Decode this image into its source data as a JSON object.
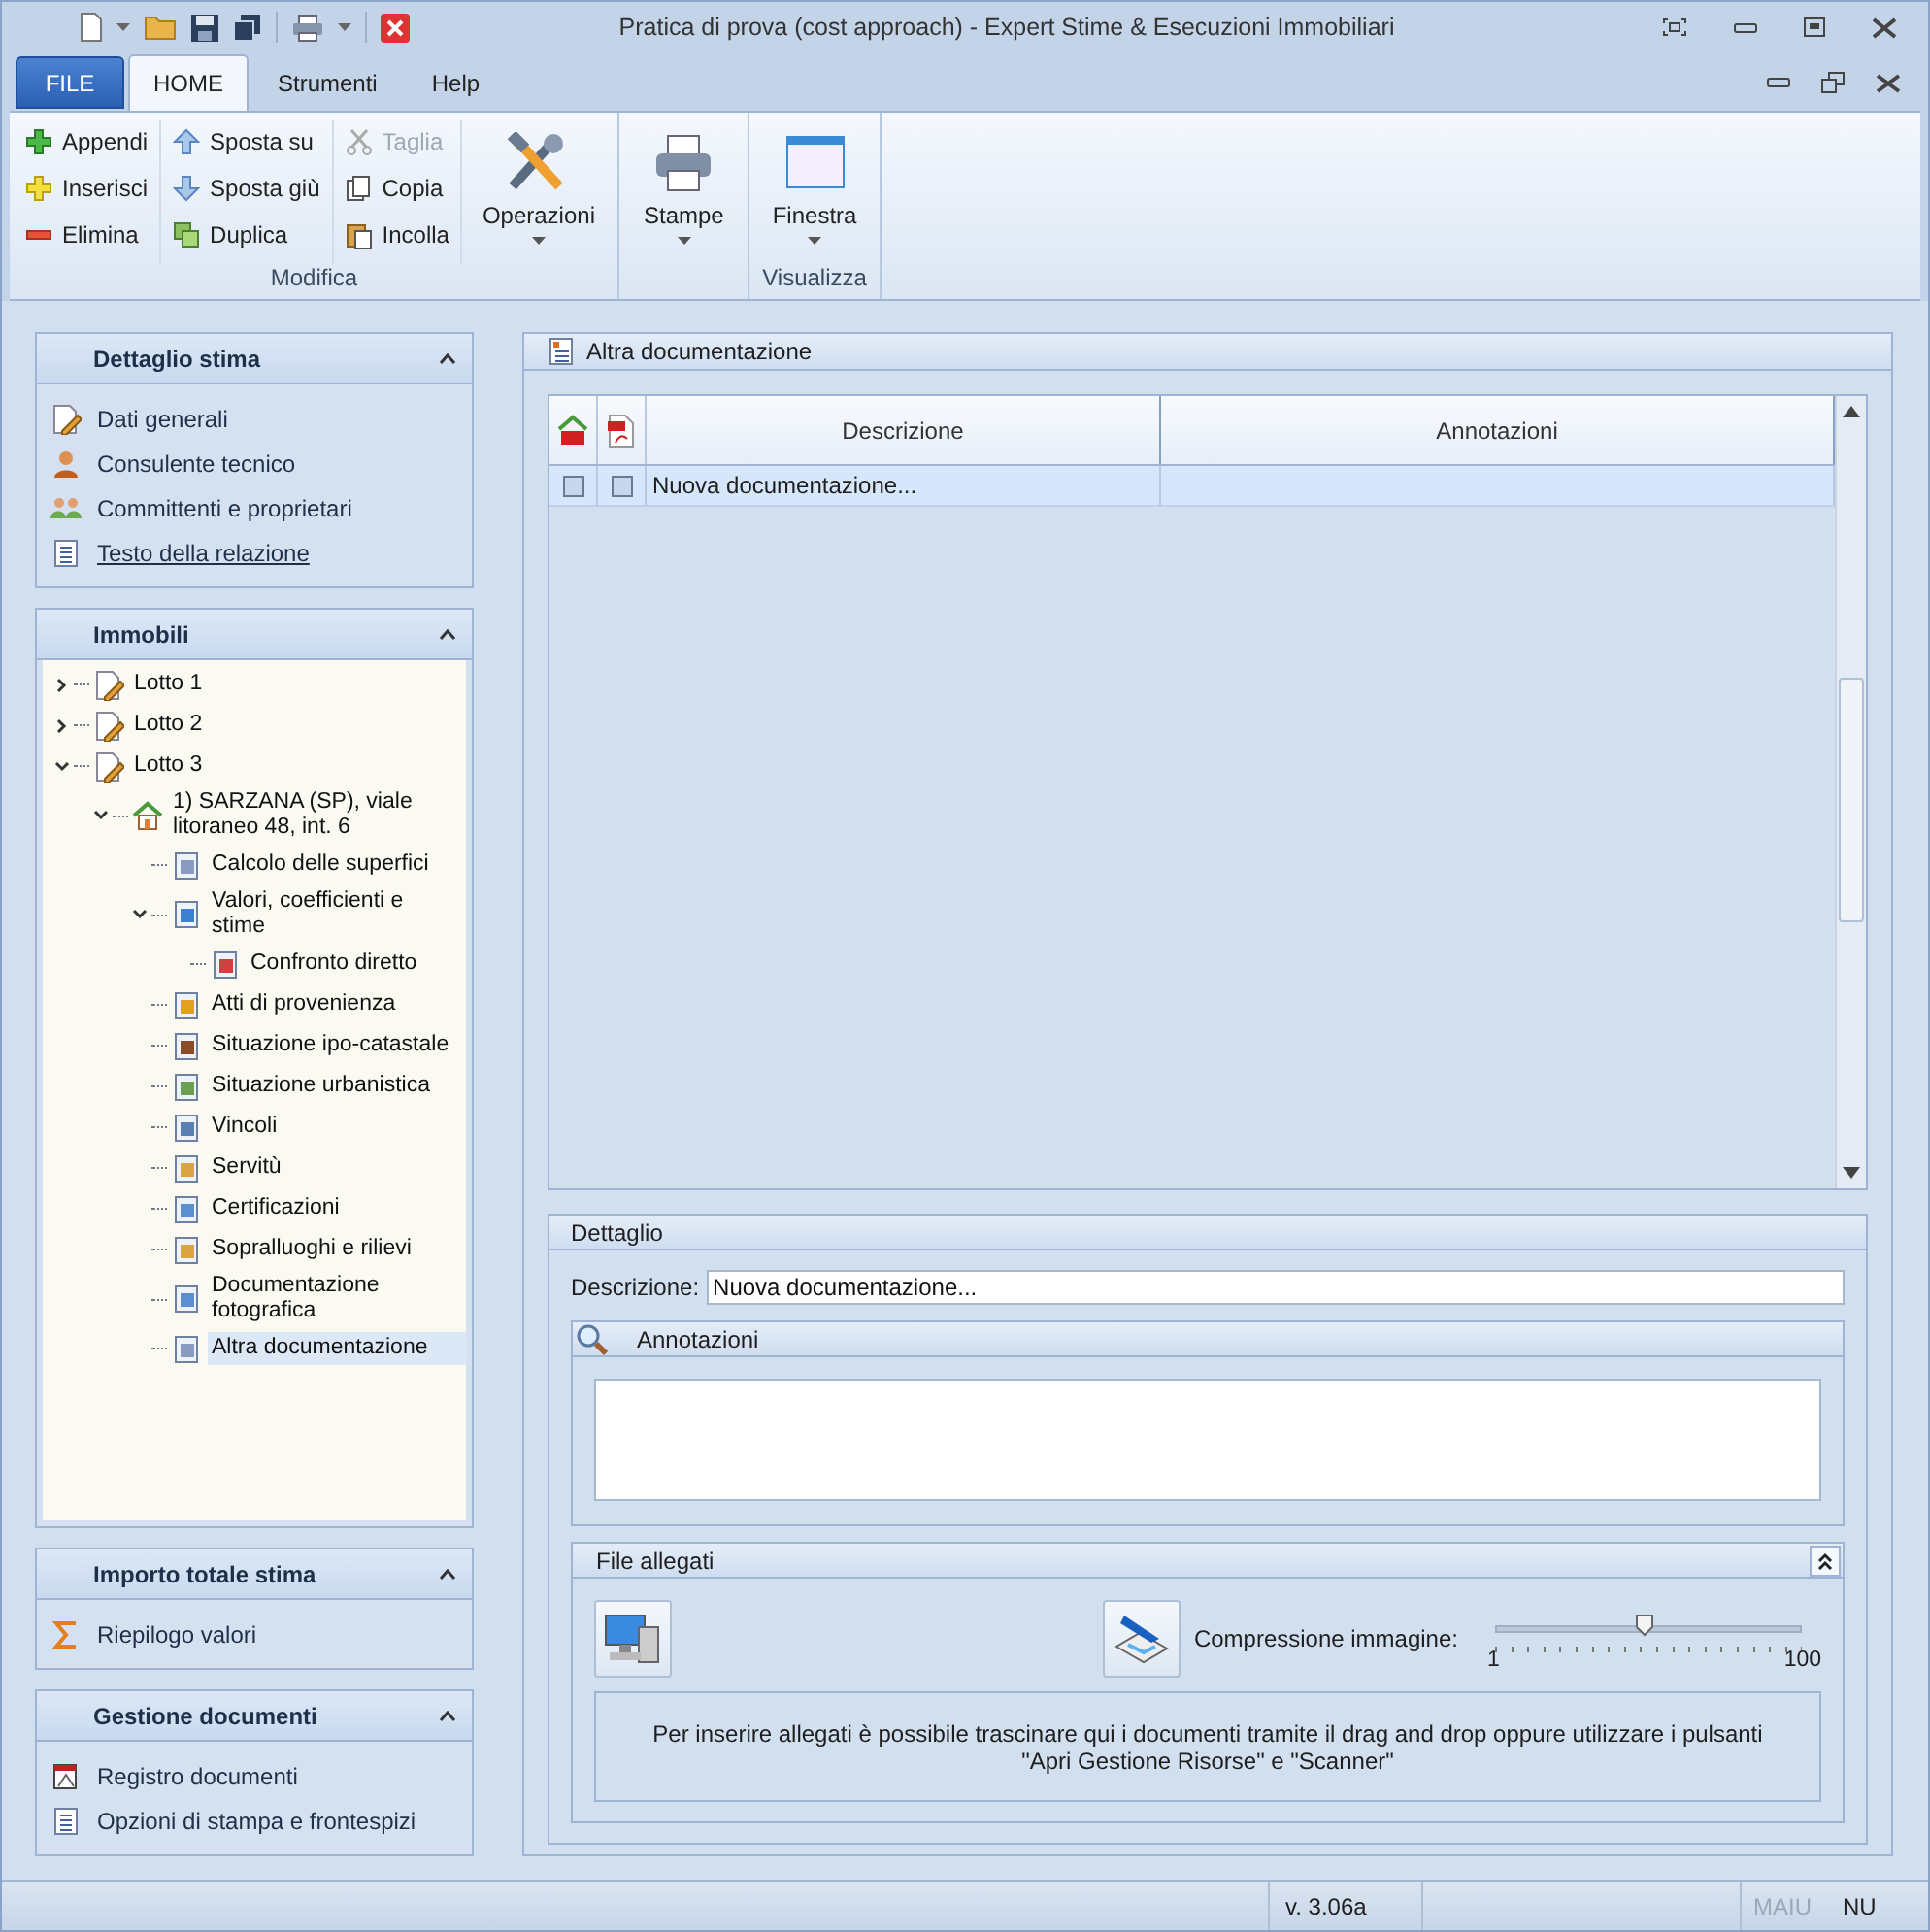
{
  "window": {
    "title": "Pratica di prova (cost approach) - Expert Stime & Esecuzioni Immobiliari"
  },
  "ribbon_tabs": [
    {
      "label": "FILE",
      "kind": "file",
      "selected": false
    },
    {
      "label": "HOME",
      "kind": "tab",
      "selected": true
    },
    {
      "label": "Strumenti",
      "kind": "tab",
      "selected": false
    },
    {
      "label": "Help",
      "kind": "tab",
      "selected": false
    }
  ],
  "ribbon_groups": [
    {
      "label": "Modifica",
      "small_columns": [
        [
          {
            "label": "Appendi",
            "disabled": false
          },
          {
            "label": "Inserisci",
            "disabled": false
          },
          {
            "label": "Elimina",
            "disabled": false
          }
        ],
        [
          {
            "label": "Sposta su",
            "disabled": false
          },
          {
            "label": "Sposta giù",
            "disabled": false
          },
          {
            "label": "Duplica",
            "disabled": false
          }
        ],
        [
          {
            "label": "Taglia",
            "disabled": true
          },
          {
            "label": "Copia",
            "disabled": false
          },
          {
            "label": "Incolla",
            "disabled": false
          }
        ]
      ],
      "large_buttons": [
        {
          "label": "Operazioni"
        }
      ]
    },
    {
      "large_buttons": [
        {
          "label": "Stampe"
        }
      ]
    },
    {
      "label": "Visualizza",
      "large_buttons": [
        {
          "label": "Finestra"
        }
      ]
    }
  ],
  "sidebar": {
    "panels": [
      {
        "title": "Dettaglio stima",
        "kind": "links",
        "expanded": true,
        "items": [
          {
            "label": "Dati generali",
            "hovered": false
          },
          {
            "label": "Consulente tecnico",
            "hovered": false
          },
          {
            "label": "Committenti e proprietari",
            "hovered": false
          },
          {
            "label": "Testo della relazione",
            "hovered": true
          }
        ]
      },
      {
        "title": "Immobili",
        "kind": "tree",
        "expanded": true,
        "tree": [
          {
            "label": "Lotto 1",
            "expanded": false,
            "selected": false
          },
          {
            "label": "Lotto 2",
            "expanded": false,
            "selected": false
          },
          {
            "label": "Lotto 3",
            "expanded": true,
            "selected": false,
            "children": [
              {
                "label": "1) SARZANA (SP), viale litoraneo 48, int. 6",
                "expanded": true,
                "selected": false,
                "children": [
                  {
                    "label": "Calcolo delle superfici",
                    "selected": false
                  },
                  {
                    "label": "Valori, coefficienti e stime",
                    "expanded": true,
                    "selected": false,
                    "children": [
                      {
                        "label": "Confronto diretto",
                        "selected": false
                      }
                    ]
                  },
                  {
                    "label": "Atti di provenienza",
                    "selected": false
                  },
                  {
                    "label": "Situazione ipo-catastale",
                    "selected": false
                  },
                  {
                    "label": "Situazione urbanistica",
                    "selected": false
                  },
                  {
                    "label": "Vincoli",
                    "selected": false
                  },
                  {
                    "label": "Servitù",
                    "selected": false
                  },
                  {
                    "label": "Certificazioni",
                    "selected": false
                  },
                  {
                    "label": "Sopralluoghi e rilievi",
                    "selected": false
                  },
                  {
                    "label": "Documentazione fotografica",
                    "selected": false
                  },
                  {
                    "label": "Altra documentazione",
                    "selected": true
                  }
                ]
              }
            ]
          }
        ]
      },
      {
        "title": "Importo totale stima",
        "kind": "links",
        "expanded": true,
        "items": [
          {
            "label": "Riepilogo valori",
            "hovered": false
          }
        ]
      },
      {
        "title": "Gestione documenti",
        "kind": "links",
        "expanded": true,
        "items": [
          {
            "label": "Registro documenti",
            "hovered": false
          },
          {
            "label": "Opzioni di stampa e frontespizi",
            "hovered": false
          }
        ]
      }
    ]
  },
  "content": {
    "title": "Altra documentazione",
    "table": {
      "columns": [
        "Descrizione",
        "Annotazioni"
      ],
      "rows": [
        {
          "home_pdf": false,
          "pdf": false,
          "descrizione": "Nuova documentazione...",
          "selected": true
        }
      ]
    },
    "detail": {
      "title": "Dettaglio",
      "description_label": "Descrizione:",
      "description_value": "Nuova documentazione...",
      "notes": {
        "title": "Annotazioni"
      },
      "attachments": {
        "title": "File allegati",
        "expanded": true,
        "compression_label": "Compressione immagine:",
        "slider": {
          "level": 0.49,
          "min_label": "1",
          "max_label": "100"
        },
        "hint": "Per inserire allegati è possibile trascinare qui i documenti tramite il drag and drop oppure utilizzare i pulsanti \"Apri Gestione Risorse\" e \"Scanner\""
      }
    }
  },
  "status_bar": {
    "version": "v. 3.06a",
    "indicators": [
      {
        "label": "MAIU",
        "active": false
      },
      {
        "label": "NU",
        "active": true
      }
    ]
  }
}
